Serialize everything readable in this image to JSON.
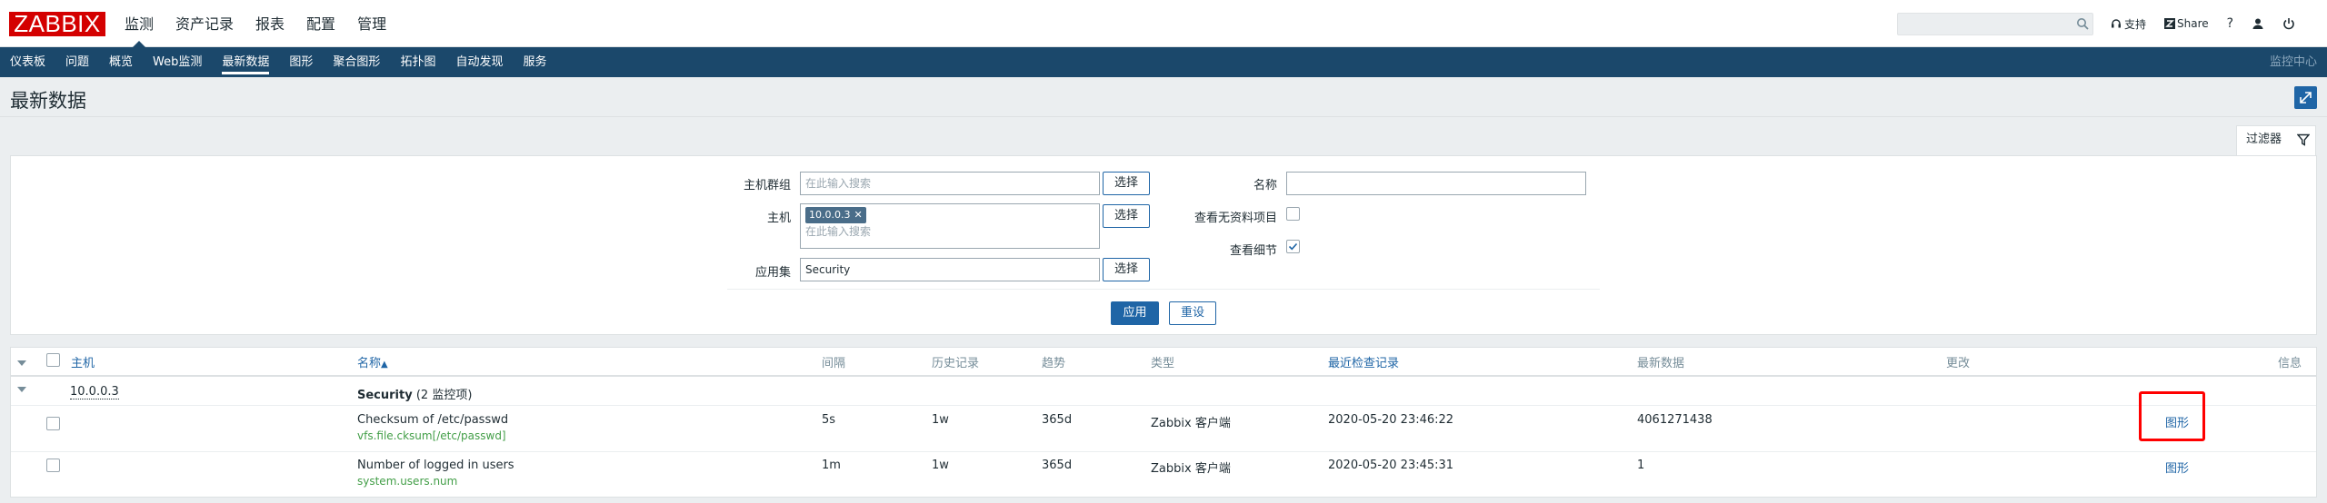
{
  "logo": "ZABBIX",
  "top_nav": [
    "监测",
    "资产记录",
    "报表",
    "配置",
    "管理"
  ],
  "top_right": {
    "support": "支持",
    "share": "Share",
    "help": "?"
  },
  "sub_nav": [
    "仪表板",
    "问题",
    "概览",
    "Web监测",
    "最新数据",
    "图形",
    "聚合图形",
    "拓扑图",
    "自动发现",
    "服务"
  ],
  "sub_nav_right": "监控中心",
  "page_title": "最新数据",
  "filter": {
    "tab_label": "过滤器",
    "host_groups_label": "主机群组",
    "host_groups_placeholder": "在此输入搜索",
    "hosts_label": "主机",
    "host_chip": "10.0.0.3",
    "hosts_placeholder": "在此输入搜索",
    "application_label": "应用集",
    "application_value": "Security",
    "select_label": "选择",
    "name_label": "名称",
    "name_value": "",
    "show_no_data_label": "查看无资料项目",
    "show_details_label": "查看细节",
    "apply_label": "应用",
    "reset_label": "重设"
  },
  "table": {
    "headers": {
      "host": "主机",
      "name": "名称",
      "sort_arrow": "▲",
      "interval": "间隔",
      "history": "历史记录",
      "trends": "趋势",
      "type": "类型",
      "last_check": "最近检查记录",
      "last_value": "最新数据",
      "change": "更改",
      "info": "信息"
    },
    "group": {
      "host": "10.0.0.3",
      "app": "Security",
      "count": "(2 监控项)"
    },
    "rows": [
      {
        "name": "Checksum of /etc/passwd",
        "key": "vfs.file.cksum[/etc/passwd]",
        "interval": "5s",
        "history": "1w",
        "trends": "365d",
        "type": "Zabbix 客户端",
        "last_check": "2020-05-20 23:46:22",
        "last_value": "4061271438",
        "change": "",
        "action": "图形"
      },
      {
        "name": "Number of logged in users",
        "key": "system.users.num",
        "interval": "1m",
        "history": "1w",
        "trends": "365d",
        "type": "Zabbix 客户端",
        "last_check": "2020-05-20 23:45:31",
        "last_value": "1",
        "change": "",
        "action": "图形"
      }
    ]
  }
}
